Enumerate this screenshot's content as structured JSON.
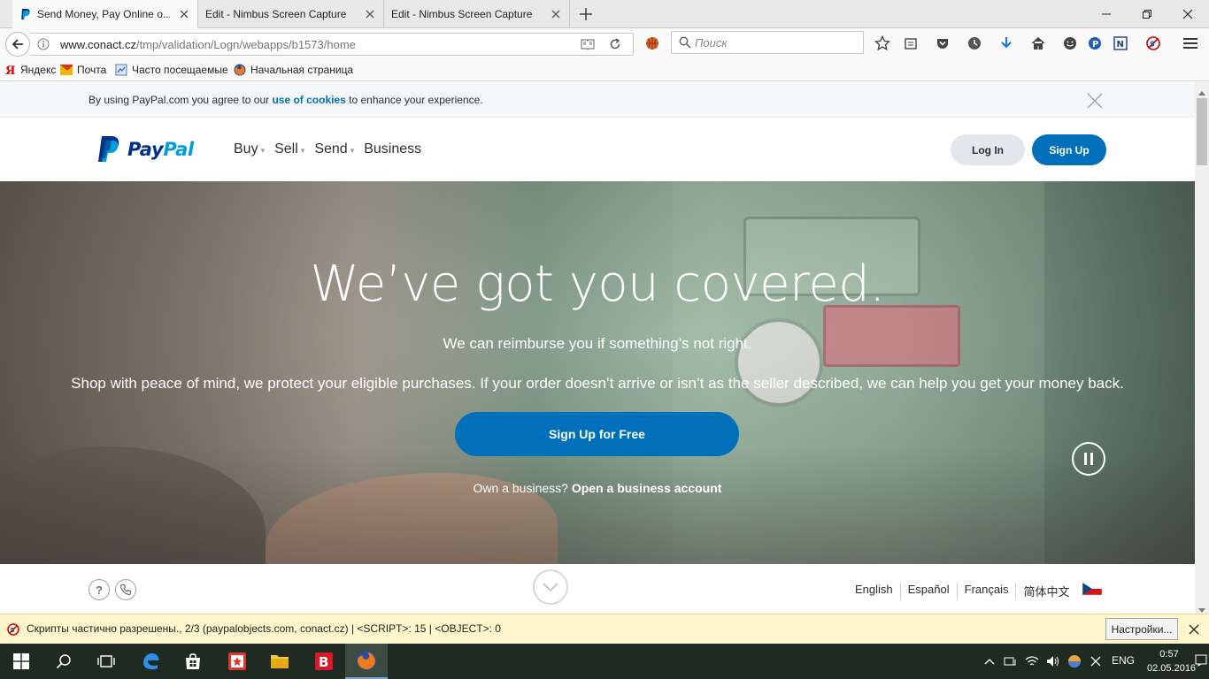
{
  "browser": {
    "tabs": [
      {
        "title": "Send Money, Pay Online o..."
      },
      {
        "title": "Edit - Nimbus Screen Capture"
      },
      {
        "title": "Edit - Nimbus Screen Capture"
      }
    ],
    "url_host": "www.conact.cz",
    "url_path": "/tmp/validation/Logn/webapps/b1573/home",
    "search_placeholder": "Поиск",
    "bookmarks": [
      {
        "label": "Яндекс"
      },
      {
        "label": "Почта"
      },
      {
        "label": "Часто посещаемые"
      },
      {
        "label": "Начальная страница"
      }
    ]
  },
  "cookie_banner": {
    "prefix": "By using PayPal.com you agree to our ",
    "link": "use of cookies",
    "suffix": " to enhance your experience."
  },
  "header": {
    "logo_pay": "Pay",
    "logo_pal": "Pal",
    "nav": [
      {
        "label": "Buy",
        "has_menu": true
      },
      {
        "label": "Sell",
        "has_menu": true
      },
      {
        "label": "Send",
        "has_menu": true
      },
      {
        "label": "Business",
        "has_menu": false
      }
    ],
    "login_label": "Log In",
    "signup_label": "Sign Up"
  },
  "hero": {
    "title": "We’ve got you covered.",
    "subtitle": "We can reimburse you if something’s not right.",
    "body": "Shop with peace of mind, we protect your eligible purchases. If your order doesn’t arrive or isn’t as the seller described, we can help you get your money back.",
    "cta_label": "Sign Up for Free",
    "biz_prefix": "Own a business? ",
    "biz_link": "Open a business account"
  },
  "footer": {
    "help_glyph": "?",
    "languages": [
      "English",
      "Español",
      "Français",
      "简体中文"
    ]
  },
  "notification": {
    "text": "Скрипты частично разрешены., 2/3 (paypalobjects.com, conact.cz) | <SCRIPT>: 15 | <OBJECT>: 0",
    "button_label": "Настройки..."
  },
  "taskbar": {
    "language": "ENG",
    "time": "0:57",
    "date": "02.05.2016"
  },
  "colors": {
    "paypal_blue": "#0070ba",
    "paypal_navy": "#003087",
    "paypal_light": "#009cde"
  }
}
